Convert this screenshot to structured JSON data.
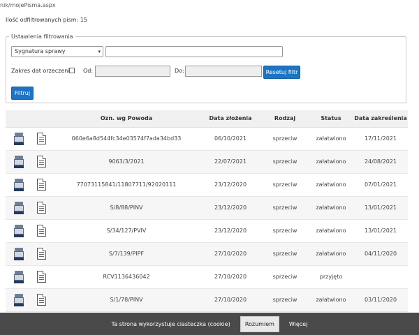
{
  "url": "nik/mojePisma.aspx",
  "filtered_count_label": "Ilość odfiltrowanych pism: 15",
  "filter": {
    "legend": "Ustawienia filtrowania",
    "signature_select": "Sygnatura sprawy",
    "signature_value": "",
    "date_range_label": "Zakres dat orzeczenia",
    "from_label": "Od:",
    "to_label": "Do:",
    "reset_button": "Resetuj filtr",
    "filter_button": "Filtruj"
  },
  "table": {
    "headers": [
      "",
      "",
      "Ozn. wg Powoda",
      "Data złożenia",
      "Rodzaj",
      "Status",
      "Data zakreślenia"
    ],
    "rows": [
      [
        "060e6a8d544fc34e03574f7ada34bd33",
        "06/10/2021",
        "sprzeciw",
        "załatwiono",
        "17/11/2021"
      ],
      [
        "9063/3/2021",
        "22/07/2021",
        "sprzeciw",
        "załatwiono",
        "24/08/2021"
      ],
      [
        "77073115841/11807711/92020111",
        "23/12/2020",
        "sprzeciw",
        "załatwiono",
        "07/01/2021"
      ],
      [
        "S/8/88/PINV",
        "23/12/2020",
        "sprzeciw",
        "załatwiono",
        "13/01/2021"
      ],
      [
        "S/34/127/PVIV",
        "23/12/2020",
        "sprzeciw",
        "załatwiono",
        "13/01/2021"
      ],
      [
        "S/7/139/PIPF",
        "27/10/2020",
        "sprzeciw",
        "załatwiono",
        "04/11/2020"
      ],
      [
        "RCV1136436042",
        "27/10/2020",
        "sprzeciw",
        "przyjęto",
        ""
      ],
      [
        "S/1/78/PINV",
        "27/10/2020",
        "sprzeciw",
        "załatwiono",
        "03/11/2020"
      ]
    ]
  },
  "icons": {
    "row_icon_1": "binder-icon",
    "row_icon_2": "document-icon"
  },
  "cookie": {
    "text": "Ta strona wykorzystuje ciasteczka (cookie)",
    "accept": "Rozumiem",
    "more": "Więcej"
  },
  "colors": {
    "primary_button": "#1c74c3",
    "cookie_bar": "#4a4a4a"
  }
}
